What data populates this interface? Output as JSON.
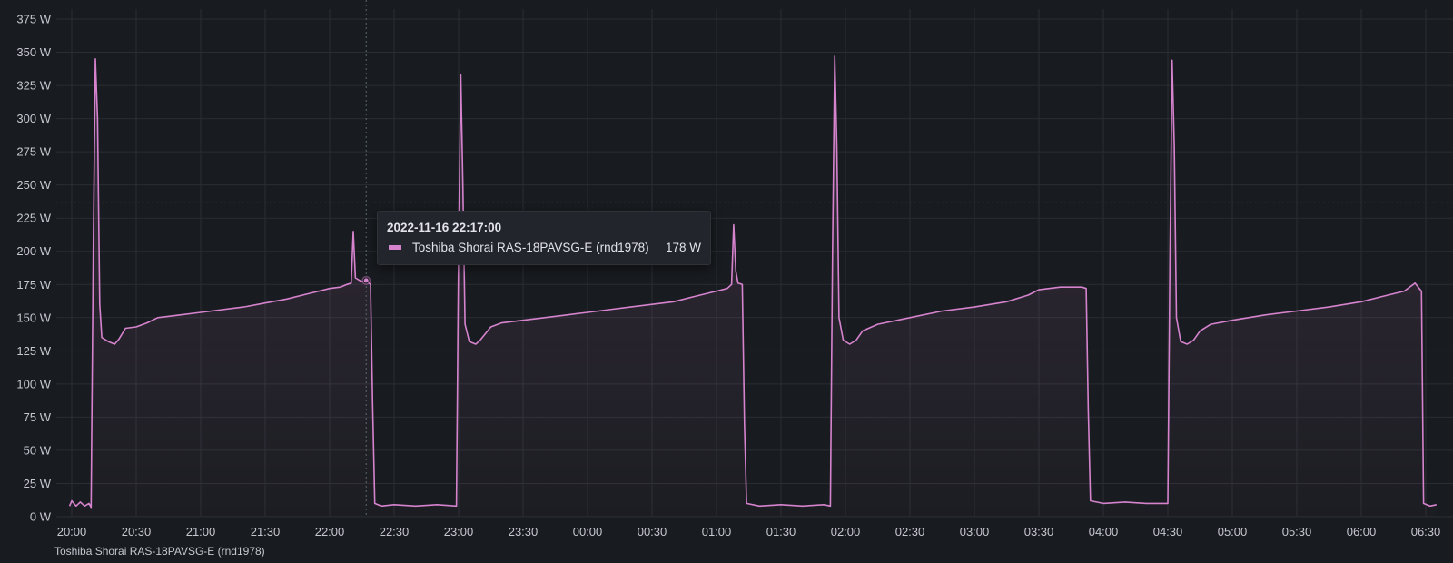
{
  "colors": {
    "background": "#181b1f",
    "grid": "#2a2d33",
    "series": "#d683ce",
    "fill": "#d683ce",
    "crosshair": "#5a6a66"
  },
  "tooltip": {
    "time": "2022-11-16 22:17:00",
    "series_name": "Toshiba Shorai RAS-18PAVSG-E (rnd1978)",
    "value": "178 W"
  },
  "legend_text": "Toshiba Shorai RAS-18PAVSG-E (rnd1978)",
  "chart_data": {
    "type": "line",
    "unit": "W",
    "ylim": [
      0,
      375
    ],
    "y_ticks": [
      0,
      25,
      50,
      75,
      100,
      125,
      150,
      175,
      200,
      225,
      250,
      275,
      300,
      325,
      350,
      375
    ],
    "y_tick_labels": [
      "0 W",
      "25 W",
      "50 W",
      "75 W",
      "100 W",
      "125 W",
      "150 W",
      "175 W",
      "200 W",
      "225 W",
      "250 W",
      "275 W",
      "300 W",
      "325 W",
      "350 W",
      "375 W"
    ],
    "x_tick_labels": [
      "20:00",
      "20:30",
      "21:00",
      "21:30",
      "22:00",
      "22:30",
      "23:00",
      "23:30",
      "00:00",
      "00:30",
      "01:00",
      "01:30",
      "02:00",
      "02:30",
      "03:00",
      "03:30",
      "04:00",
      "04:30",
      "05:00",
      "05:30",
      "06:00",
      "06:30"
    ],
    "x_start": "2022-11-16 20:00",
    "x_tick_step_minutes": 30,
    "grid": true,
    "fill": "area",
    "crosshair": {
      "time": "2022-11-16 22:17:00",
      "value": 178
    },
    "horizontal_marker": 237,
    "series": [
      {
        "name": "Toshiba Shorai RAS-18PAVSG-E (rnd1978)",
        "points": [
          [
            "19:59",
            8
          ],
          [
            "20:00",
            12
          ],
          [
            "20:02",
            8
          ],
          [
            "20:04",
            11
          ],
          [
            "20:06",
            8
          ],
          [
            "20:08",
            10
          ],
          [
            "20:09",
            7
          ],
          [
            "20:10",
            200
          ],
          [
            "20:11",
            345
          ],
          [
            "20:12",
            300
          ],
          [
            "20:13",
            160
          ],
          [
            "20:14",
            135
          ],
          [
            "20:17",
            132
          ],
          [
            "20:20",
            130
          ],
          [
            "20:22",
            134
          ],
          [
            "20:25",
            142
          ],
          [
            "20:30",
            143
          ],
          [
            "20:35",
            146
          ],
          [
            "20:40",
            150
          ],
          [
            "20:50",
            152
          ],
          [
            "21:00",
            154
          ],
          [
            "21:10",
            156
          ],
          [
            "21:20",
            158
          ],
          [
            "21:30",
            161
          ],
          [
            "21:40",
            164
          ],
          [
            "21:50",
            168
          ],
          [
            "22:00",
            172
          ],
          [
            "22:05",
            173
          ],
          [
            "22:08",
            175
          ],
          [
            "22:10",
            176
          ],
          [
            "22:11",
            215
          ],
          [
            "22:12",
            180
          ],
          [
            "22:15",
            177
          ],
          [
            "22:17",
            178
          ],
          [
            "22:19",
            175
          ],
          [
            "22:20",
            85
          ],
          [
            "22:21",
            10
          ],
          [
            "22:24",
            8
          ],
          [
            "22:30",
            9
          ],
          [
            "22:40",
            8
          ],
          [
            "22:50",
            9
          ],
          [
            "22:59",
            8
          ],
          [
            "23:00",
            200
          ],
          [
            "23:01",
            333
          ],
          [
            "23:02",
            250
          ],
          [
            "23:03",
            145
          ],
          [
            "23:05",
            132
          ],
          [
            "23:08",
            130
          ],
          [
            "23:10",
            133
          ],
          [
            "23:15",
            143
          ],
          [
            "23:20",
            146
          ],
          [
            "23:30",
            148
          ],
          [
            "23:40",
            150
          ],
          [
            "23:50",
            152
          ],
          [
            "00:00",
            154
          ],
          [
            "00:10",
            156
          ],
          [
            "00:20",
            158
          ],
          [
            "00:30",
            160
          ],
          [
            "00:40",
            162
          ],
          [
            "00:50",
            166
          ],
          [
            "01:00",
            170
          ],
          [
            "01:05",
            172
          ],
          [
            "01:07",
            175
          ],
          [
            "01:08",
            220
          ],
          [
            "01:09",
            185
          ],
          [
            "01:10",
            176
          ],
          [
            "01:12",
            175
          ],
          [
            "01:13",
            70
          ],
          [
            "01:14",
            10
          ],
          [
            "01:20",
            8
          ],
          [
            "01:30",
            9
          ],
          [
            "01:40",
            8
          ],
          [
            "01:50",
            9
          ],
          [
            "01:53",
            8
          ],
          [
            "01:54",
            200
          ],
          [
            "01:55",
            347
          ],
          [
            "01:56",
            280
          ],
          [
            "01:57",
            150
          ],
          [
            "01:59",
            133
          ],
          [
            "02:02",
            130
          ],
          [
            "02:05",
            133
          ],
          [
            "02:08",
            140
          ],
          [
            "02:15",
            145
          ],
          [
            "02:30",
            150
          ],
          [
            "02:45",
            155
          ],
          [
            "03:00",
            158
          ],
          [
            "03:15",
            162
          ],
          [
            "03:25",
            167
          ],
          [
            "03:30",
            171
          ],
          [
            "03:40",
            173
          ],
          [
            "03:50",
            173
          ],
          [
            "03:52",
            172
          ],
          [
            "03:53",
            80
          ],
          [
            "03:54",
            12
          ],
          [
            "04:00",
            10
          ],
          [
            "04:10",
            11
          ],
          [
            "04:20",
            10
          ],
          [
            "04:30",
            10
          ],
          [
            "04:31",
            200
          ],
          [
            "04:32",
            344
          ],
          [
            "04:33",
            280
          ],
          [
            "04:34",
            150
          ],
          [
            "04:36",
            132
          ],
          [
            "04:39",
            130
          ],
          [
            "04:42",
            133
          ],
          [
            "04:45",
            140
          ],
          [
            "04:50",
            145
          ],
          [
            "05:00",
            148
          ],
          [
            "05:15",
            152
          ],
          [
            "05:30",
            155
          ],
          [
            "05:45",
            158
          ],
          [
            "06:00",
            162
          ],
          [
            "06:10",
            166
          ],
          [
            "06:20",
            170
          ],
          [
            "06:25",
            176
          ],
          [
            "06:27",
            172
          ],
          [
            "06:28",
            170
          ],
          [
            "06:29",
            10
          ],
          [
            "06:32",
            8
          ],
          [
            "06:35",
            9
          ]
        ]
      }
    ]
  }
}
